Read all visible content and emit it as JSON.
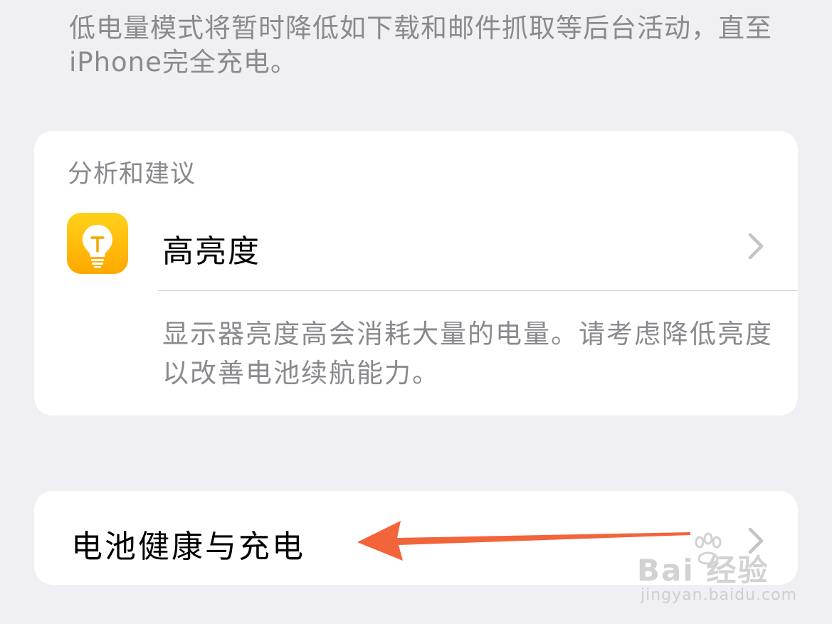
{
  "low_power": {
    "description": "低电量模式将暂时降低如下载和邮件抓取等后台活动，直至iPhone完全充电。"
  },
  "insights": {
    "section_title": "分析和建议",
    "item": {
      "label": "高亮度",
      "icon": "lightbulb-icon",
      "description": "显示器亮度高会消耗大量的电量。请考虑降低亮度以改善电池续航能力。"
    }
  },
  "battery_health": {
    "label": "电池健康与充电"
  },
  "watermark": {
    "logo": "Bai 经验",
    "url": "jingyan.baidu.com"
  },
  "colors": {
    "background": "#efeff4",
    "card": "#ffffff",
    "secondary_text": "#8a8a8e",
    "icon_yellow": "#ffc107",
    "annotation_arrow": "#f2643a"
  }
}
